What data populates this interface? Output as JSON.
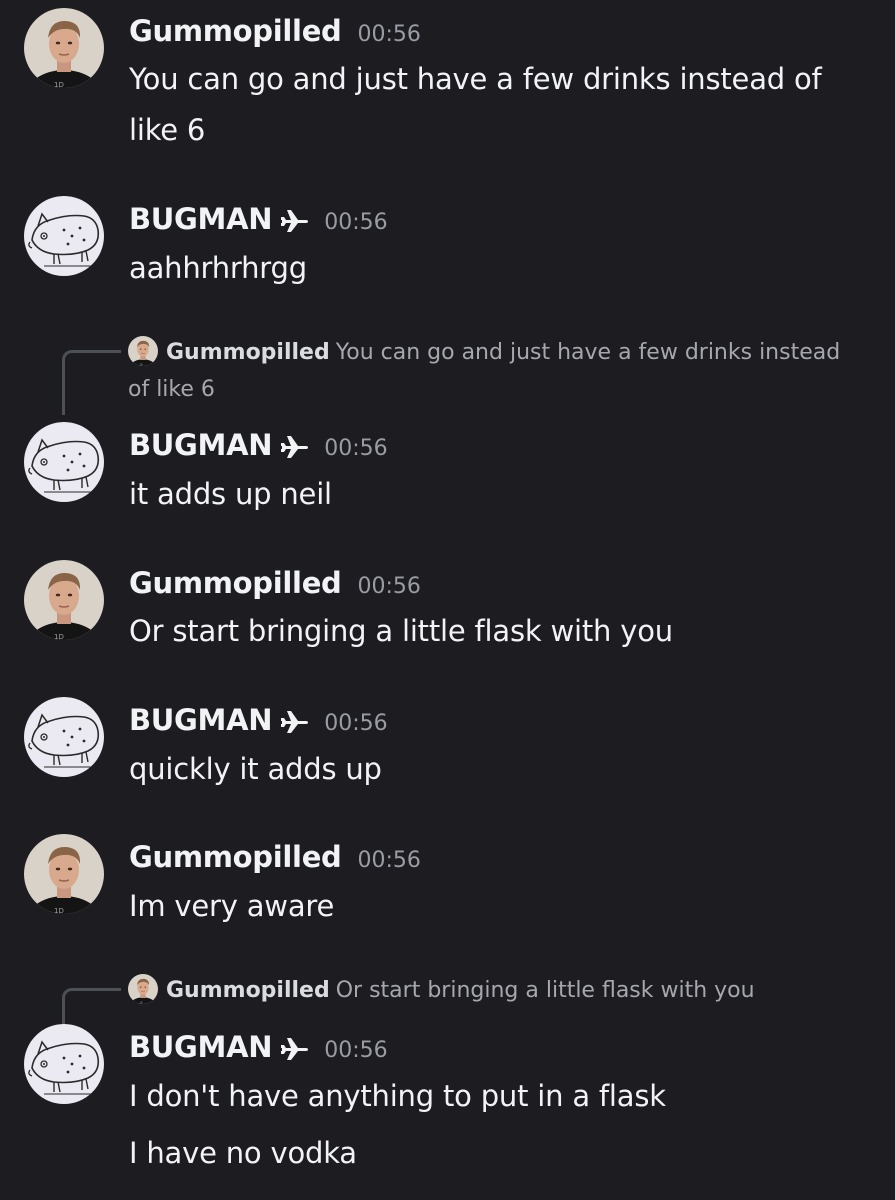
{
  "theme": {
    "background": "#1c1c21",
    "text": "#f2f3f5",
    "muted": "#9a9ca3",
    "reply_line": "#4e5058"
  },
  "icons": {
    "user_badge": "airplane-icon",
    "gummo_avatar": "portrait-avatar",
    "bugman_avatar": "spotted-pig-drawing-avatar"
  },
  "messages": [
    {
      "author": "Gummopilled",
      "time": "00:56",
      "lines": [
        "You can go and just have a few drinks instead of",
        "like 6"
      ]
    },
    {
      "author": "BUGMAN",
      "time": "00:56",
      "lines": [
        "aahhrhrhrgg"
      ]
    },
    {
      "author": "BUGMAN",
      "time": "00:56",
      "reply": {
        "author": "Gummopilled",
        "text_line1": "You can go and just have a few drinks instead",
        "text_line2": "of like 6"
      },
      "lines": [
        "it adds up neil"
      ]
    },
    {
      "author": "Gummopilled",
      "time": "00:56",
      "lines": [
        "Or start bringing a little flask with you"
      ]
    },
    {
      "author": "BUGMAN",
      "time": "00:56",
      "lines": [
        "quickly it adds up"
      ]
    },
    {
      "author": "Gummopilled",
      "time": "00:56",
      "lines": [
        "Im very aware"
      ]
    },
    {
      "author": "BUGMAN",
      "time": "00:56",
      "reply": {
        "author": "Gummopilled",
        "text_line1": "Or start bringing a little flask with you"
      },
      "lines": [
        "I don't have anything to put in a flask",
        "I have no vodka"
      ]
    }
  ]
}
